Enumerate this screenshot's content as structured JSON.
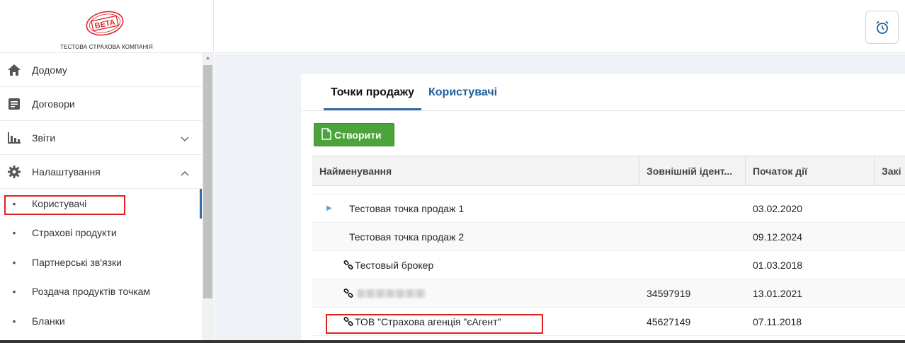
{
  "company": {
    "stamp_text": "BETA",
    "name": "ТЕСТОВА СТРАХОВА КОМПАНІЯ"
  },
  "sidebar": {
    "items": [
      {
        "label": "Додому",
        "icon": "home-icon"
      },
      {
        "label": "Договори",
        "icon": "document-icon"
      },
      {
        "label": "Звіти",
        "icon": "bar-chart-icon"
      },
      {
        "label": "Налаштування",
        "icon": "gear-icon"
      }
    ],
    "subitems": [
      {
        "label": "Користувачі"
      },
      {
        "label": "Страхові продукти"
      },
      {
        "label": "Партнерські зв'язки"
      },
      {
        "label": "Роздача продуктів точкам"
      },
      {
        "label": "Бланки"
      }
    ]
  },
  "tabs": [
    {
      "label": "Точки продажу"
    },
    {
      "label": "Користувачі"
    }
  ],
  "create_button": {
    "label": "Створити"
  },
  "table": {
    "headers": [
      "Найменування",
      "Зовнішній ідент...",
      "Початок дії",
      "Закі"
    ],
    "rows": [
      {
        "name": "Тестовая точка продаж 1",
        "ext_id": "",
        "start": "03.02.2020",
        "type": "caret"
      },
      {
        "name": "Тестовая точка продаж 2",
        "ext_id": "",
        "start": "09.12.2024",
        "type": "plain"
      },
      {
        "name": "Тестовый брокер",
        "ext_id": "",
        "start": "01.03.2018",
        "type": "link"
      },
      {
        "name": "",
        "ext_id": "34597919",
        "start": "13.01.2021",
        "type": "link-blur"
      },
      {
        "name": "ТОВ \"Страхова агенція \"єАгент\"",
        "ext_id": "45627149",
        "start": "07.11.2018",
        "type": "link"
      }
    ]
  },
  "colors": {
    "accent": "#2e6da4",
    "create_green": "#4aa43a",
    "highlight_red": "#e02020"
  }
}
